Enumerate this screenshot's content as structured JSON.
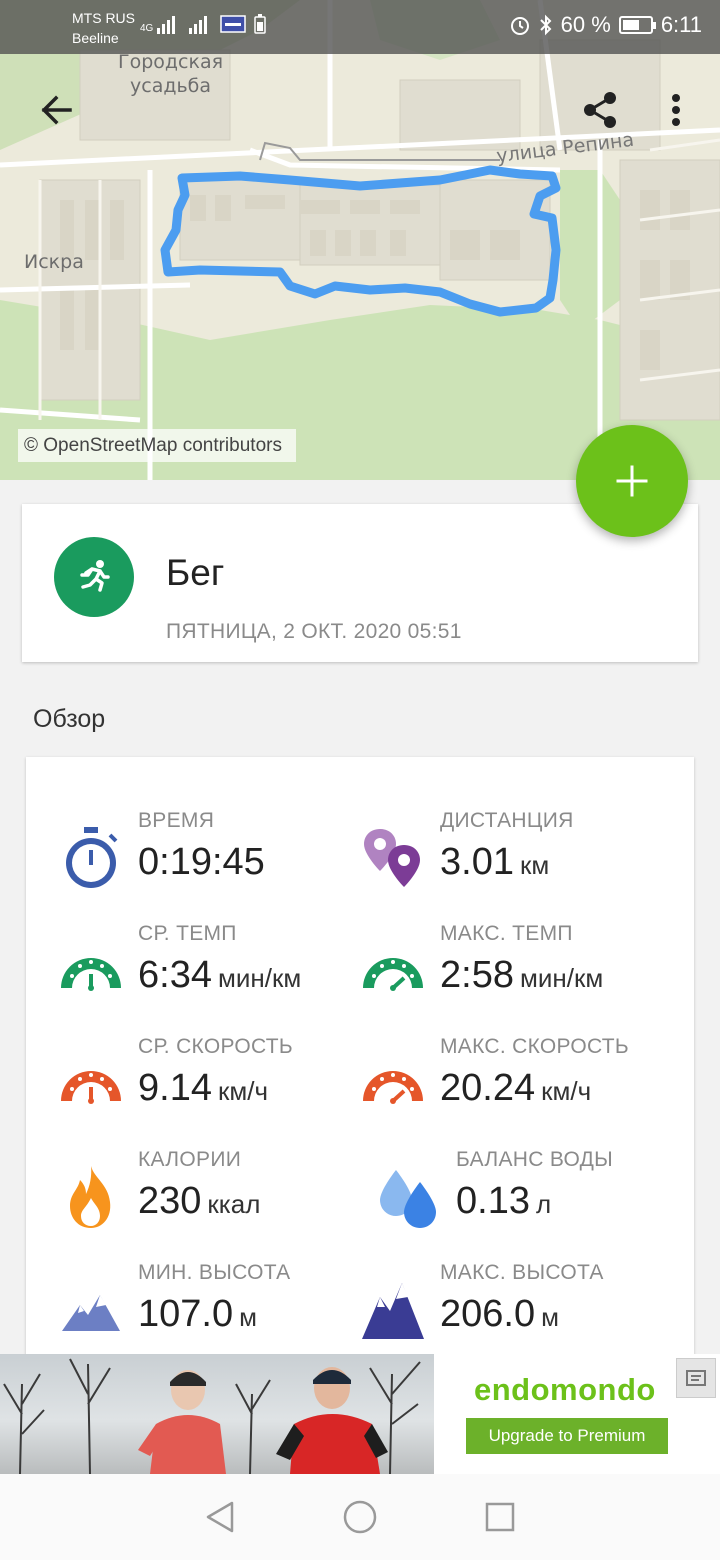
{
  "status_bar": {
    "carrier1": "MTS RUS",
    "carrier2": "Beeline",
    "network": "4G",
    "battery_percent": "60 %",
    "battery_level": 0.6,
    "time": "6:11"
  },
  "map": {
    "labels": {
      "gorodskaya": "Городская\nусадьба",
      "repina": "улица Репина",
      "iskra": "Искра"
    },
    "attribution": "© OpenStreetMap contributors",
    "route_color": "#4c9df0"
  },
  "toolbar": {
    "back_icon": "arrow-left-icon",
    "share_icon": "share-icon",
    "menu_icon": "more-vert-icon"
  },
  "fab": {
    "icon": "plus-icon",
    "color": "#6cc11a"
  },
  "workout": {
    "sport": "Бег",
    "date": "ПЯТНИЦА, 2 ОКТ. 2020 05:51",
    "avatar_color": "#1a9b5e",
    "icon": "runner-icon"
  },
  "overview": {
    "title": "Обзор",
    "stats": [
      {
        "id": "time",
        "label": "ВРЕМЯ",
        "value": "0:19:45",
        "unit": "",
        "icon": "stopwatch-icon",
        "color": "#3b5cab"
      },
      {
        "id": "distance",
        "label": "ДИСТАНЦИЯ",
        "value": "3.01",
        "unit": "км",
        "icon": "location-pin-icon",
        "color": "#7c3c96"
      },
      {
        "id": "avg-pace",
        "label": "СР. ТЕМП",
        "value": "6:34",
        "unit": "мин/км",
        "icon": "gauge-icon",
        "color": "#1a9b5e"
      },
      {
        "id": "max-pace",
        "label": "МАКС. ТЕМП",
        "value": "2:58",
        "unit": "мин/км",
        "icon": "gauge-icon",
        "color": "#1a9b5e"
      },
      {
        "id": "avg-speed",
        "label": "СР. СКОРОСТЬ",
        "value": "9.14",
        "unit": "км/ч",
        "icon": "speedometer-icon",
        "color": "#e5562a"
      },
      {
        "id": "max-speed",
        "label": "МАКС. СКОРОСТЬ",
        "value": "20.24",
        "unit": "км/ч",
        "icon": "speedometer-icon",
        "color": "#e5562a"
      },
      {
        "id": "calories",
        "label": "КАЛОРИИ",
        "value": "230",
        "unit": "ккал",
        "icon": "flame-icon",
        "color": "#f7941d"
      },
      {
        "id": "water",
        "label": "БАЛАНС ВОДЫ",
        "value": "0.13",
        "unit": "л",
        "icon": "water-drops-icon",
        "color": "#3b82e4"
      },
      {
        "id": "min-alt",
        "label": "МИН. ВЫСОТА",
        "value": "107.0",
        "unit": "м",
        "icon": "mountain-icon",
        "color": "#6c7fc4"
      },
      {
        "id": "max-alt",
        "label": "МАКС. ВЫСОТА",
        "value": "206.0",
        "unit": "м",
        "icon": "mountain-icon",
        "color": "#3a3c94"
      }
    ]
  },
  "ad": {
    "brand": "endomondo",
    "button": "Upgrade to Premium"
  },
  "navbar": {
    "back_icon": "nav-back-icon",
    "home_icon": "nav-home-icon",
    "recents_icon": "nav-recents-icon"
  }
}
